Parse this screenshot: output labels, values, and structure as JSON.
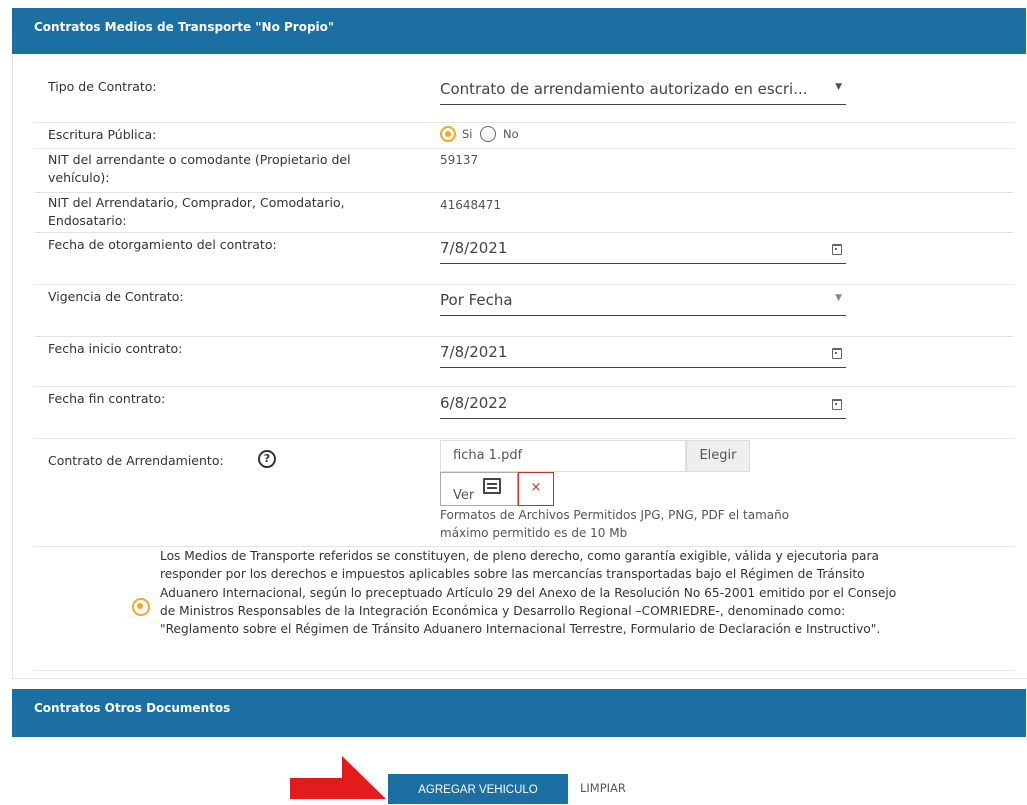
{
  "section1": {
    "title": "Contratos Medios de Transporte \"No Propio\""
  },
  "fields": {
    "tipo_contrato": {
      "label": "Tipo de Contrato:",
      "value": "Contrato de arrendamiento autorizado en escri..."
    },
    "escritura": {
      "label": "Escritura Pública:",
      "options": [
        "Si",
        "No"
      ],
      "selected": "Si"
    },
    "nit_arrendante": {
      "label": "NIT del arrendante o comodante (Propietario del vehículo):",
      "value": "59137"
    },
    "nit_arrendatario": {
      "label": "NIT del Arrendatario, Comprador, Comodatario, Endosatario:",
      "value": "41648471"
    },
    "fecha_otorgamiento": {
      "label": "Fecha de otorgamiento del contrato:",
      "value": "7/8/2021"
    },
    "vigencia": {
      "label": "Vigencia de Contrato:",
      "value": "Por Fecha"
    },
    "fecha_inicio": {
      "label": "Fecha inicio contrato:",
      "value": "7/8/2021"
    },
    "fecha_fin": {
      "label": "Fecha fin contrato:",
      "value": "6/8/2022"
    },
    "contrato_arrendamiento": {
      "label": "Contrato de Arrendamiento:",
      "help": "?",
      "file_name": "ficha 1.pdf",
      "choose_label": "Elegir",
      "view_label": "Ver",
      "remove_label": "×",
      "note": "Formatos de Archivos Permitidos JPG, PNG, PDF el tamaño máximo permitido es de 10 Mb"
    }
  },
  "legal_text": "Los Medios de Transporte referidos se constituyen, de pleno derecho, como garantía exigible, válida y ejecutoria para responder por los derechos e impuestos aplicables sobre las mercancías transportadas bajo el Régimen de Tránsito Aduanero Internacional, según lo preceptuado Artículo 29 del Anexo de la Resolución No 65-2001 emitido por el Consejo de Ministros Responsables de la Integración Económica y Desarrollo Regional –COMRIEDRE-, denominado como: \"Reglamento sobre el Régimen de Tránsito Aduanero Internacional Terrestre, Formulario de Declaración e Instructivo\".",
  "section2": {
    "title": "Contratos Otros Documentos"
  },
  "actions": {
    "add_vehicle": "AGREGAR VEHICULO",
    "clear": "LIMPIAR"
  },
  "colors": {
    "header": "#1b6fa3",
    "accent": "#f5a623",
    "danger": "#c9302c",
    "arrow": "#e31b1b"
  },
  "icons": [
    "dropdown-caret-icon",
    "calendar-icon",
    "help-icon",
    "document-icon",
    "close-icon",
    "arrow-icon"
  ]
}
